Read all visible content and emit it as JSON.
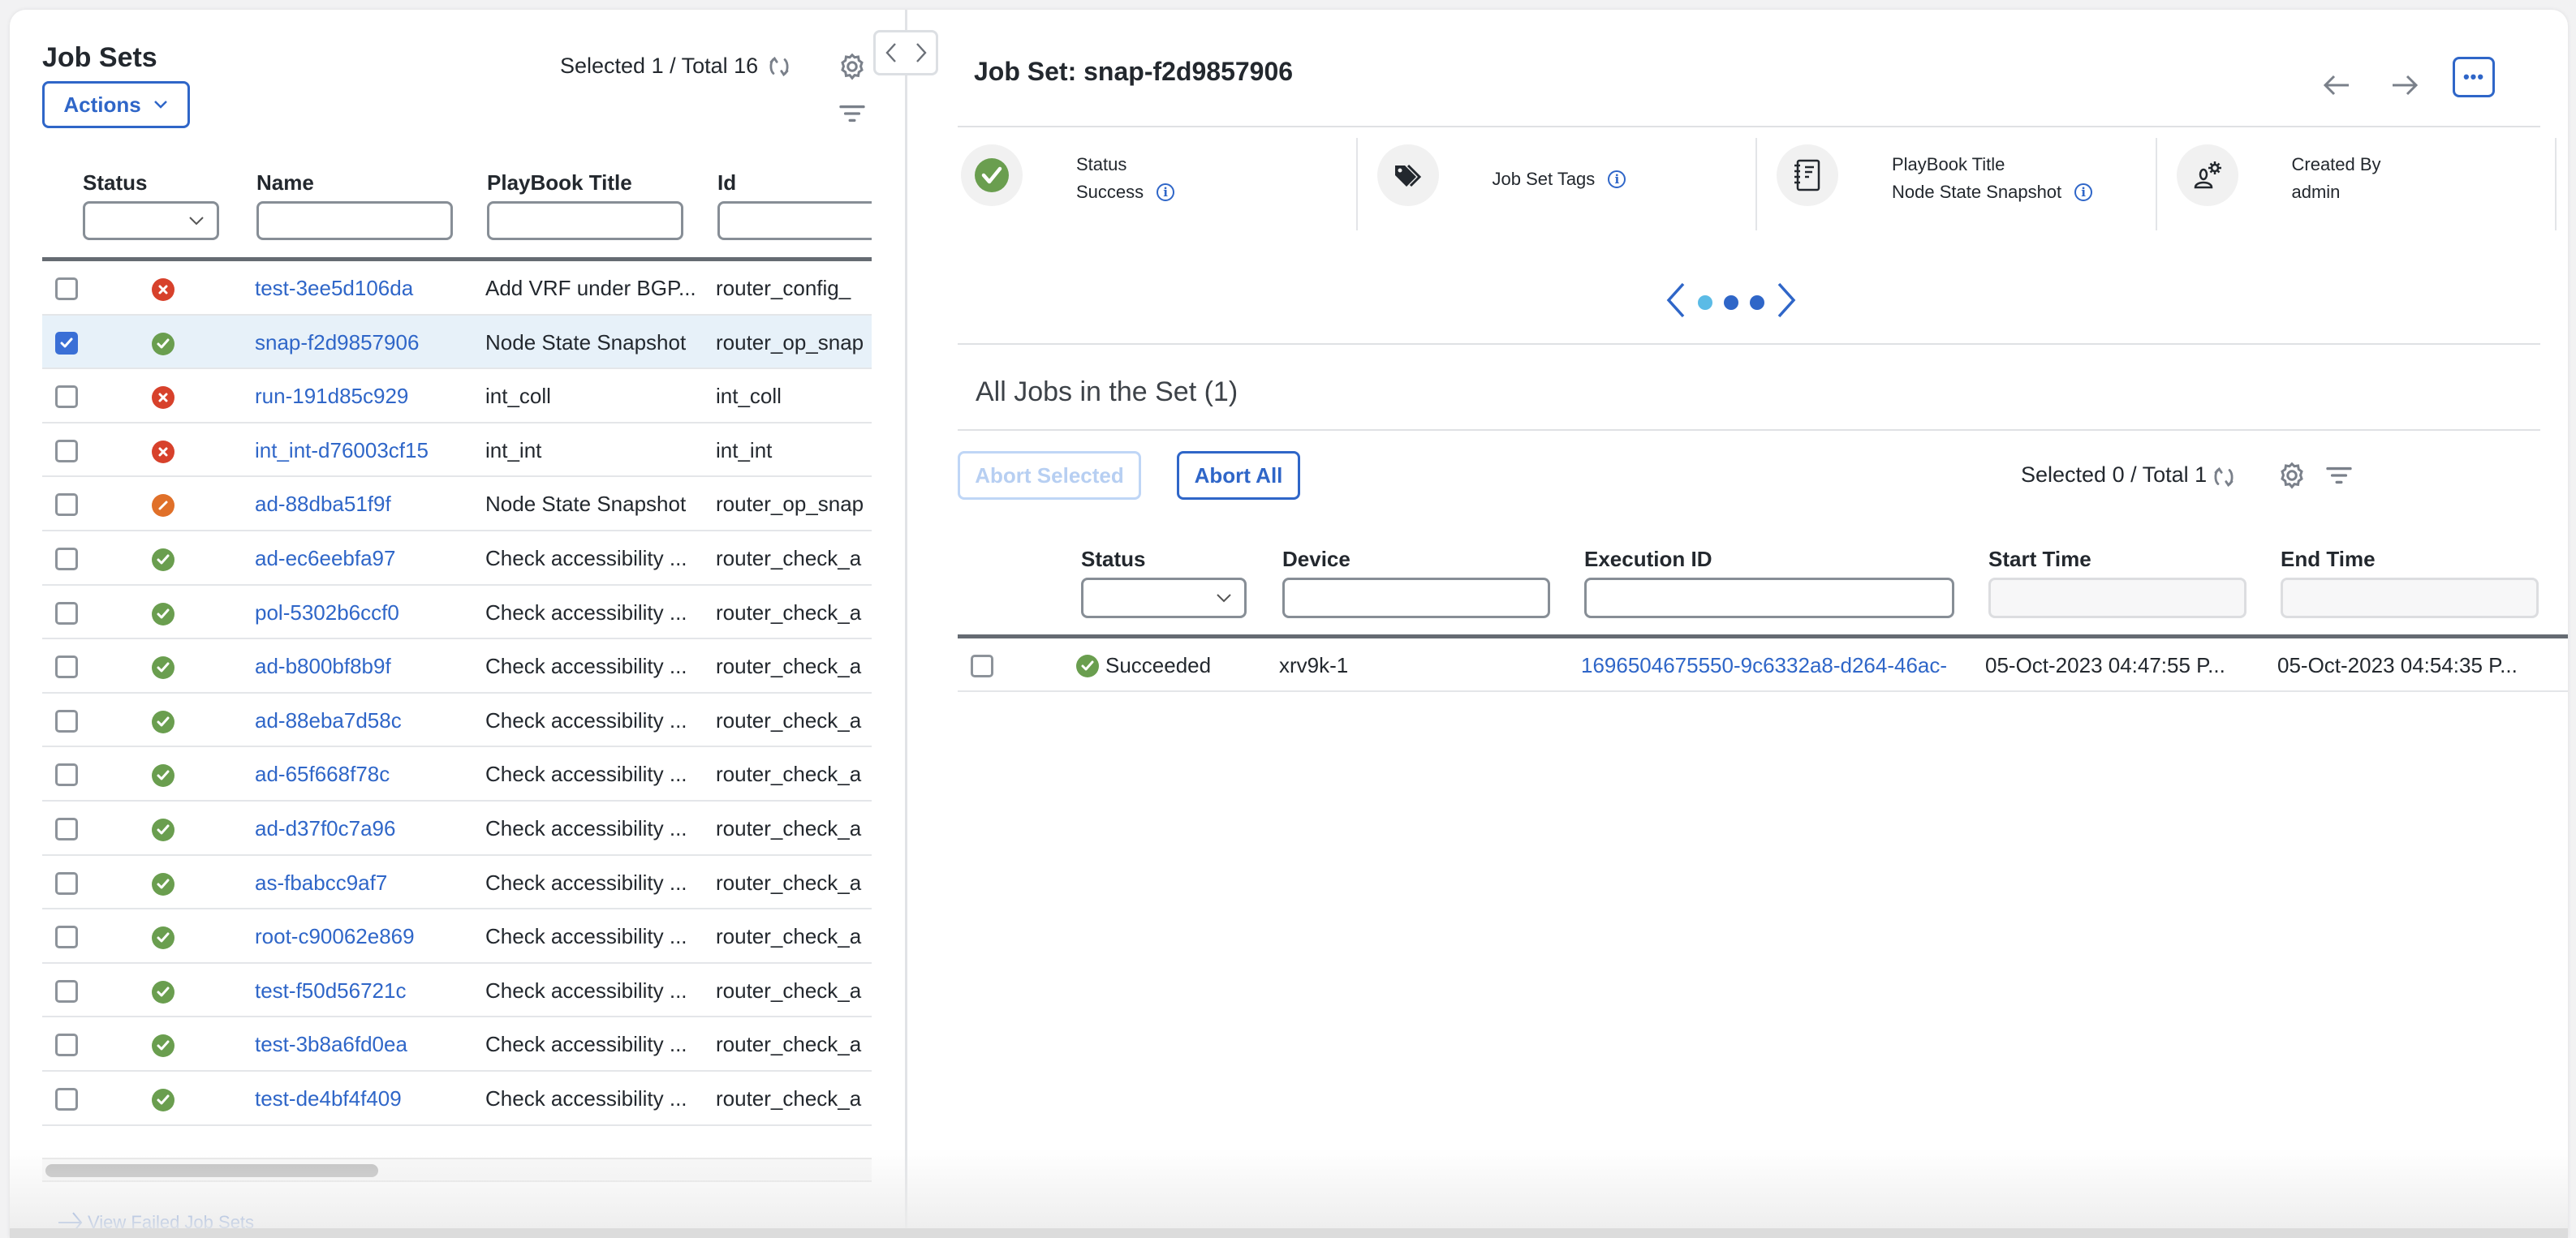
{
  "left_panel": {
    "title": "Job Sets",
    "selection_status": "Selected 1 / Total 16",
    "actions_label": "Actions",
    "columns": [
      "Status",
      "Name",
      "PlayBook Title",
      "Id"
    ],
    "rows": [
      {
        "checked": false,
        "status": "failed",
        "name": "test-3ee5d106da",
        "playbook_title": "Add VRF under BGP...",
        "id": "router_config_"
      },
      {
        "checked": true,
        "status": "success",
        "name": "snap-f2d9857906",
        "playbook_title": "Node State Snapshot",
        "id": "router_op_snap"
      },
      {
        "checked": false,
        "status": "failed",
        "name": "run-191d85c929",
        "playbook_title": "int_coll",
        "id": "int_coll"
      },
      {
        "checked": false,
        "status": "failed",
        "name": "int_int-d76003cf15",
        "playbook_title": "int_int",
        "id": "int_int"
      },
      {
        "checked": false,
        "status": "aborted",
        "name": "ad-88dba51f9f",
        "playbook_title": "Node State Snapshot",
        "id": "router_op_snap"
      },
      {
        "checked": false,
        "status": "success",
        "name": "ad-ec6eebfa97",
        "playbook_title": "Check accessibility ...",
        "id": "router_check_a"
      },
      {
        "checked": false,
        "status": "success",
        "name": "pol-5302b6ccf0",
        "playbook_title": "Check accessibility ...",
        "id": "router_check_a"
      },
      {
        "checked": false,
        "status": "success",
        "name": "ad-b800bf8b9f",
        "playbook_title": "Check accessibility ...",
        "id": "router_check_a"
      },
      {
        "checked": false,
        "status": "success",
        "name": "ad-88eba7d58c",
        "playbook_title": "Check accessibility ...",
        "id": "router_check_a"
      },
      {
        "checked": false,
        "status": "success",
        "name": "ad-65f668f78c",
        "playbook_title": "Check accessibility ...",
        "id": "router_check_a"
      },
      {
        "checked": false,
        "status": "success",
        "name": "ad-d37f0c7a96",
        "playbook_title": "Check accessibility ...",
        "id": "router_check_a"
      },
      {
        "checked": false,
        "status": "success",
        "name": "as-fbabcc9af7",
        "playbook_title": "Check accessibility ...",
        "id": "router_check_a"
      },
      {
        "checked": false,
        "status": "success",
        "name": "root-c90062e869",
        "playbook_title": "Check accessibility ...",
        "id": "router_check_a"
      },
      {
        "checked": false,
        "status": "success",
        "name": "test-f50d56721c",
        "playbook_title": "Check accessibility ...",
        "id": "router_check_a"
      },
      {
        "checked": false,
        "status": "success",
        "name": "test-3b8a6fd0ea",
        "playbook_title": "Check accessibility ...",
        "id": "router_check_a"
      },
      {
        "checked": false,
        "status": "success",
        "name": "test-de4bf4f409",
        "playbook_title": "Check accessibility ...",
        "id": "router_check_a"
      }
    ],
    "view_failed_label": "View Failed Job Sets"
  },
  "right_panel": {
    "title": "Job Set: snap-f2d9857906",
    "info": {
      "status_label": "Status",
      "status_value": "Success",
      "tags_label": "Job Set Tags",
      "playbook_label": "PlayBook Title",
      "playbook_value": "Node State Snapshot",
      "created_by_label": "Created By",
      "created_by_value": "admin"
    },
    "pager": {
      "pages": 3,
      "active_page": 1
    },
    "section_title": "All Jobs in the Set (1)",
    "abort_selected_label": "Abort Selected",
    "abort_all_label": "Abort All",
    "selection_status": "Selected 0 / Total 1",
    "columns": [
      "Status",
      "Device",
      "Execution ID",
      "Start Time",
      "End Time"
    ],
    "jobs": [
      {
        "checked": false,
        "status": "Succeeded",
        "device": "xrv9k-1",
        "execution_id": "1696504675550-9c6332a8-d264-46ac-",
        "start_time": "05-Oct-2023 04:47:55 P...",
        "end_time": "05-Oct-2023 04:54:35 P..."
      }
    ]
  },
  "colors": {
    "accent": "#2f66c8",
    "success": "#6a9e4f",
    "failed": "#d7412b",
    "aborted": "#e07029",
    "selected_row": "#e7f1f9"
  }
}
